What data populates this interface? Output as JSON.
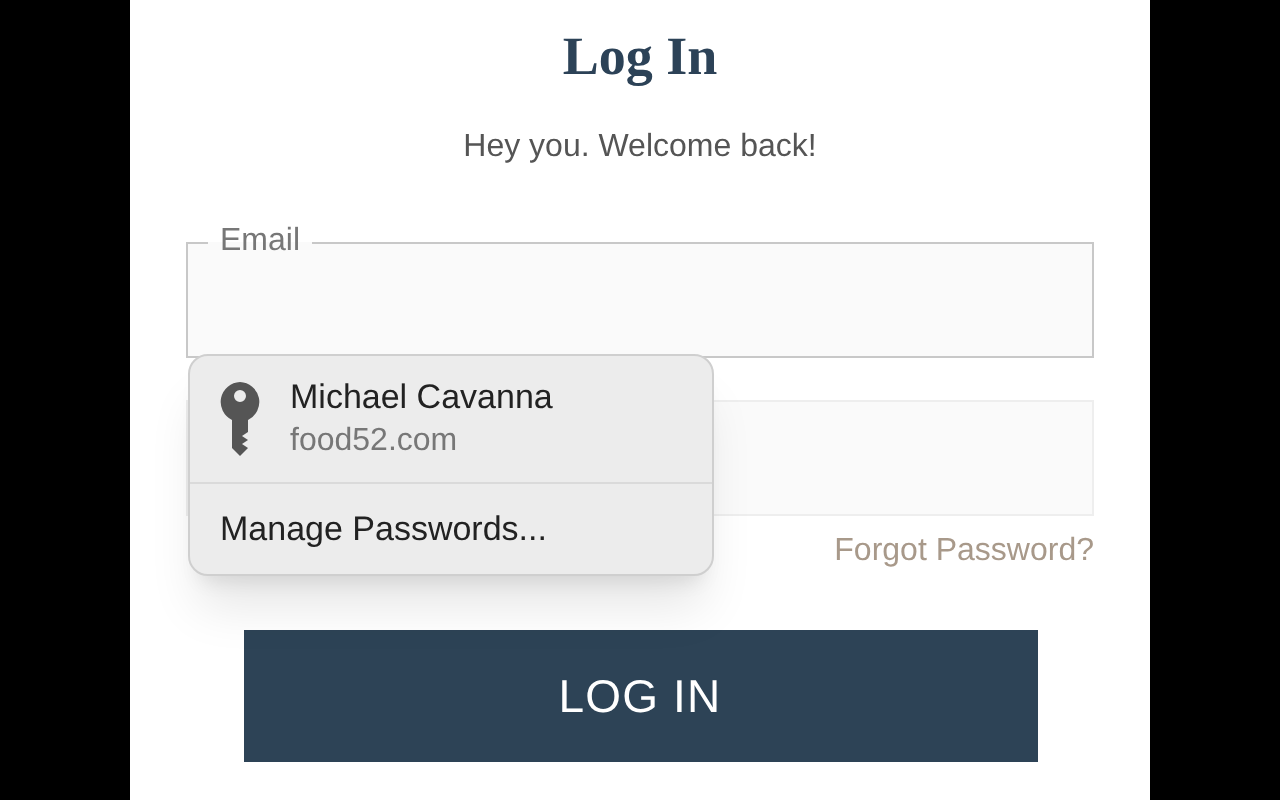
{
  "title": "Log In",
  "subtitle": "Hey you. Welcome back!",
  "email_field": {
    "label": "Email"
  },
  "forgot_link": "Forgot Password?",
  "submit_button": "LOG IN",
  "autofill_popup": {
    "account": {
      "name": "Michael Cavanna",
      "site": "food52.com"
    },
    "manage": "Manage Passwords..."
  }
}
